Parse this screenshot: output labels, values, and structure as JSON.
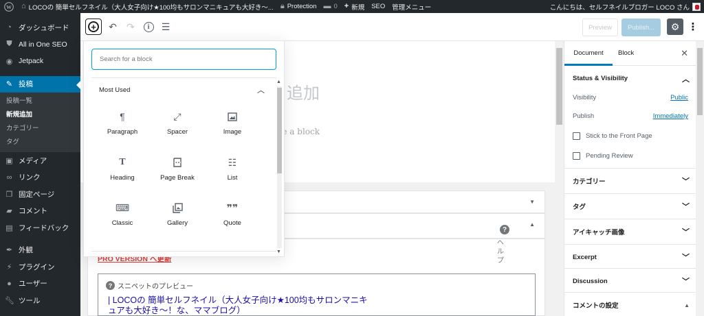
{
  "admin_bar": {
    "site_name": "LOCOの 簡単セルフネイル（大人女子向け★100均もサロンマニキュアも大好き〜...",
    "protection_label": "Protection",
    "comments_count": "0",
    "new_label": "新規",
    "seo_label": "SEO",
    "manage_menu_label": "管理メニュー",
    "greeting": "こんにちは、セルフネイルブロガー LOCO さん"
  },
  "sidebar": {
    "items": [
      {
        "label": "ダッシュボード",
        "icon": "dashboard-icon"
      },
      {
        "label": "All in One SEO",
        "icon": "shield-icon"
      },
      {
        "label": "Jetpack",
        "icon": "jetpack-icon"
      },
      {
        "label": "投稿",
        "icon": "pushpin-icon"
      },
      {
        "label": "メディア",
        "icon": "media-icon"
      },
      {
        "label": "リンク",
        "icon": "link-icon"
      },
      {
        "label": "固定ページ",
        "icon": "pages-icon"
      },
      {
        "label": "コメント",
        "icon": "comment-icon"
      },
      {
        "label": "フィードバック",
        "icon": "feedback-icon"
      },
      {
        "label": "外観",
        "icon": "appearance-icon"
      },
      {
        "label": "プラグイン",
        "icon": "plugin-icon"
      },
      {
        "label": "ユーザー",
        "icon": "user-icon"
      },
      {
        "label": "ツール",
        "icon": "tool-icon"
      }
    ],
    "submenu": [
      "投稿一覧",
      "新規追加",
      "カテゴリー",
      "タグ"
    ]
  },
  "toolbar": {
    "preview_label": "Preview",
    "publish_label": "Publish..."
  },
  "inserter": {
    "search_placeholder": "Search for a block",
    "panel_title": "Most Used",
    "blocks": [
      {
        "label": "Paragraph",
        "icon": "paragraph-icon"
      },
      {
        "label": "Spacer",
        "icon": "spacer-icon"
      },
      {
        "label": "Image",
        "icon": "image-icon"
      },
      {
        "label": "Heading",
        "icon": "heading-icon"
      },
      {
        "label": "Page Break",
        "icon": "page-break-icon"
      },
      {
        "label": "List",
        "icon": "list-icon"
      },
      {
        "label": "Classic",
        "icon": "keyboard-icon"
      },
      {
        "label": "Gallery",
        "icon": "gallery-icon"
      },
      {
        "label": "Quote",
        "icon": "quote-icon"
      }
    ]
  },
  "canvas": {
    "title_fragment": "追加",
    "block_prompt_fragment": "ose a block",
    "help_label": "ヘルプ",
    "pro_link": "PRO VERSION へ更新",
    "snippet_heading": "スニペットのプレビュー",
    "snippet_title": "| LOCOの 簡単セルフネイル（大人女子向け★100均もサロンマニキュアも大好き〜！な、ママブログ）"
  },
  "settings": {
    "tab_document": "Document",
    "tab_block": "Block",
    "status_visibility": "Status & Visibility",
    "visibility_label": "Visibility",
    "visibility_value": "Public",
    "publish_label": "Publish",
    "publish_value": "Immediately",
    "stick_label": "Stick to the Front Page",
    "pending_label": "Pending Review",
    "panels": [
      "カテゴリー",
      "タグ",
      "アイキャッチ画像",
      "Excerpt",
      "Discussion",
      "コメントの設定"
    ]
  }
}
